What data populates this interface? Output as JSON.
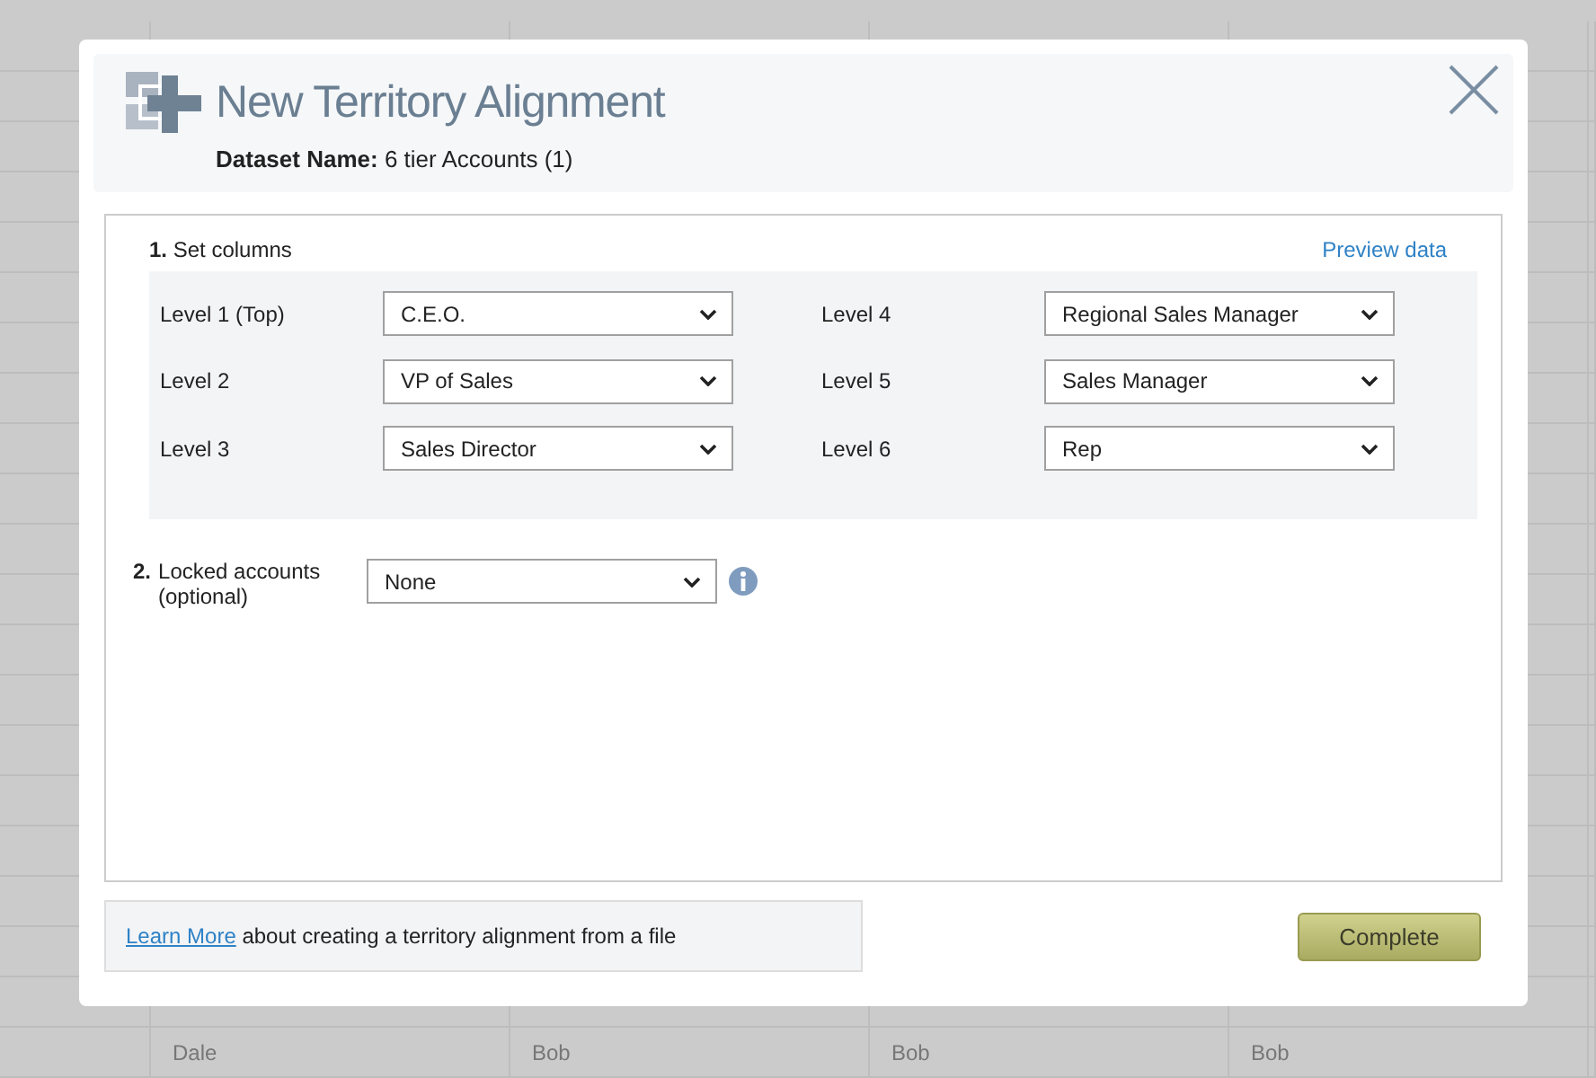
{
  "background_table": {
    "rows": [
      [
        "Dale",
        "Bob",
        "Bob",
        "Bob"
      ]
    ]
  },
  "dialog": {
    "title": "New Territory Alignment",
    "dataset_label": "Dataset Name:",
    "dataset_name": "6 tier Accounts (1)",
    "step1": {
      "number": "1.",
      "label": "Set columns",
      "link": "Preview data",
      "levels": [
        {
          "label": "Level 1 (Top)",
          "value": "C.E.O."
        },
        {
          "label": "Level 2",
          "value": "VP of Sales"
        },
        {
          "label": "Level 3",
          "value": "Sales Director"
        },
        {
          "label": "Level 4",
          "value": "Regional Sales Manager"
        },
        {
          "label": "Level 5",
          "value": "Sales Manager"
        },
        {
          "label": "Level 6",
          "value": "Rep"
        }
      ]
    },
    "step2": {
      "number": "2.",
      "label": "Locked accounts (optional)",
      "value": "None"
    },
    "footer": {
      "link": "Learn More",
      "text": "about creating a territory alignment from a file",
      "button": "Complete"
    }
  }
}
